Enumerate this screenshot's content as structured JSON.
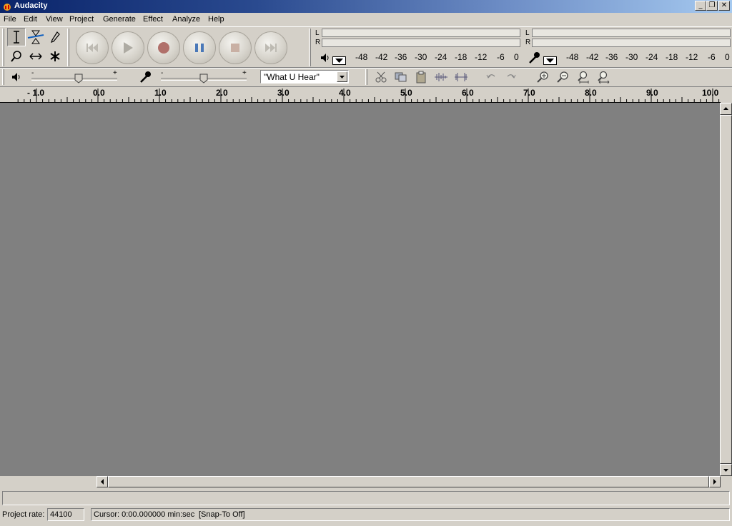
{
  "window": {
    "title": "Audacity",
    "min": "_",
    "restore": "❐",
    "close": "✕"
  },
  "menu": [
    "File",
    "Edit",
    "View",
    "Project",
    "Generate",
    "Effect",
    "Analyze",
    "Help"
  ],
  "meters": {
    "play_channels": [
      "L",
      "R"
    ],
    "rec_channels": [
      "L",
      "R"
    ],
    "scale": [
      "-48",
      "-42",
      "-36",
      "-30",
      "-24",
      "-18",
      "-12",
      "-6",
      "0"
    ]
  },
  "mixer": {
    "minus": "-",
    "plus": "+",
    "input_source": "\"What U Hear\"",
    "play_volume": 0.55,
    "rec_volume": 0.5
  },
  "ruler": {
    "labels": [
      "- 1.0",
      "0.0",
      "1.0",
      "2.0",
      "3.0",
      "4.0",
      "5.0",
      "6.0",
      "7.0",
      "8.0",
      "9.0",
      "10.0"
    ]
  },
  "status": {
    "project_rate_label": "Project rate:",
    "project_rate_value": "44100",
    "cursor_text": "Cursor: 0:00.000000 min:sec",
    "snap_text": "[Snap-To Off]"
  },
  "colors": {
    "track_area": "#808080",
    "record_red": "#b0706a",
    "pause_blue": "#4a78b8"
  }
}
